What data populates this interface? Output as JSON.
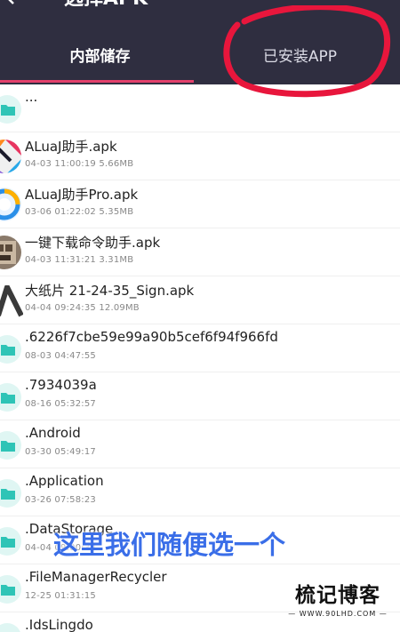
{
  "header": {
    "title": "选择APK",
    "tabs": [
      {
        "label": "内部储存"
      },
      {
        "label": "已安装APP"
      }
    ]
  },
  "files": [
    {
      "name": "...",
      "meta": "",
      "icon": "folder-icon"
    },
    {
      "name": "ALuaJ助手.apk",
      "meta": "04-03 11:00:19  5.66MB",
      "icon": "aluaj-app-icon"
    },
    {
      "name": "ALuaJ助手Pro.apk",
      "meta": "03-06 01:22:02  5.35MB",
      "icon": "aluaj-pro-app-icon"
    },
    {
      "name": "一键下载命令助手.apk",
      "meta": "04-03 11:31:21  3.31MB",
      "icon": "download-helper-app-icon"
    },
    {
      "name": "大纸片 21-24-35_Sign.apk",
      "meta": "04-04 09:24:35  12.09MB",
      "icon": "paper-app-icon"
    },
    {
      "name": ".6226f7cbe59e99a90b5cef6f94f966fd",
      "meta": "08-03 04:47:55",
      "icon": "folder-icon"
    },
    {
      "name": ".7934039a",
      "meta": "08-16 05:32:57",
      "icon": "folder-icon"
    },
    {
      "name": ".Android",
      "meta": "03-30 05:49:17",
      "icon": "folder-icon"
    },
    {
      "name": ".Application",
      "meta": "03-26 07:58:23",
      "icon": "folder-icon"
    },
    {
      "name": ".DataStorage",
      "meta": "04-04 09:00:39",
      "icon": "folder-icon"
    },
    {
      "name": ".FileManagerRecycler",
      "meta": "12-25 01:31:15",
      "icon": "folder-icon"
    },
    {
      "name": ".IdsLingdo",
      "meta": "",
      "icon": "folder-icon"
    }
  ],
  "overlay": {
    "caption": "这里我们随便选一个"
  },
  "watermark": {
    "title": "梳记博客",
    "url": "— WWW.90LHD.COM —"
  },
  "colors": {
    "header_bg": "#2f2e40",
    "tab_indicator": "#e3406b",
    "annotation_circle": "#e8163c",
    "folder": "#2ec4b6",
    "caption": "#3a6ee8"
  }
}
